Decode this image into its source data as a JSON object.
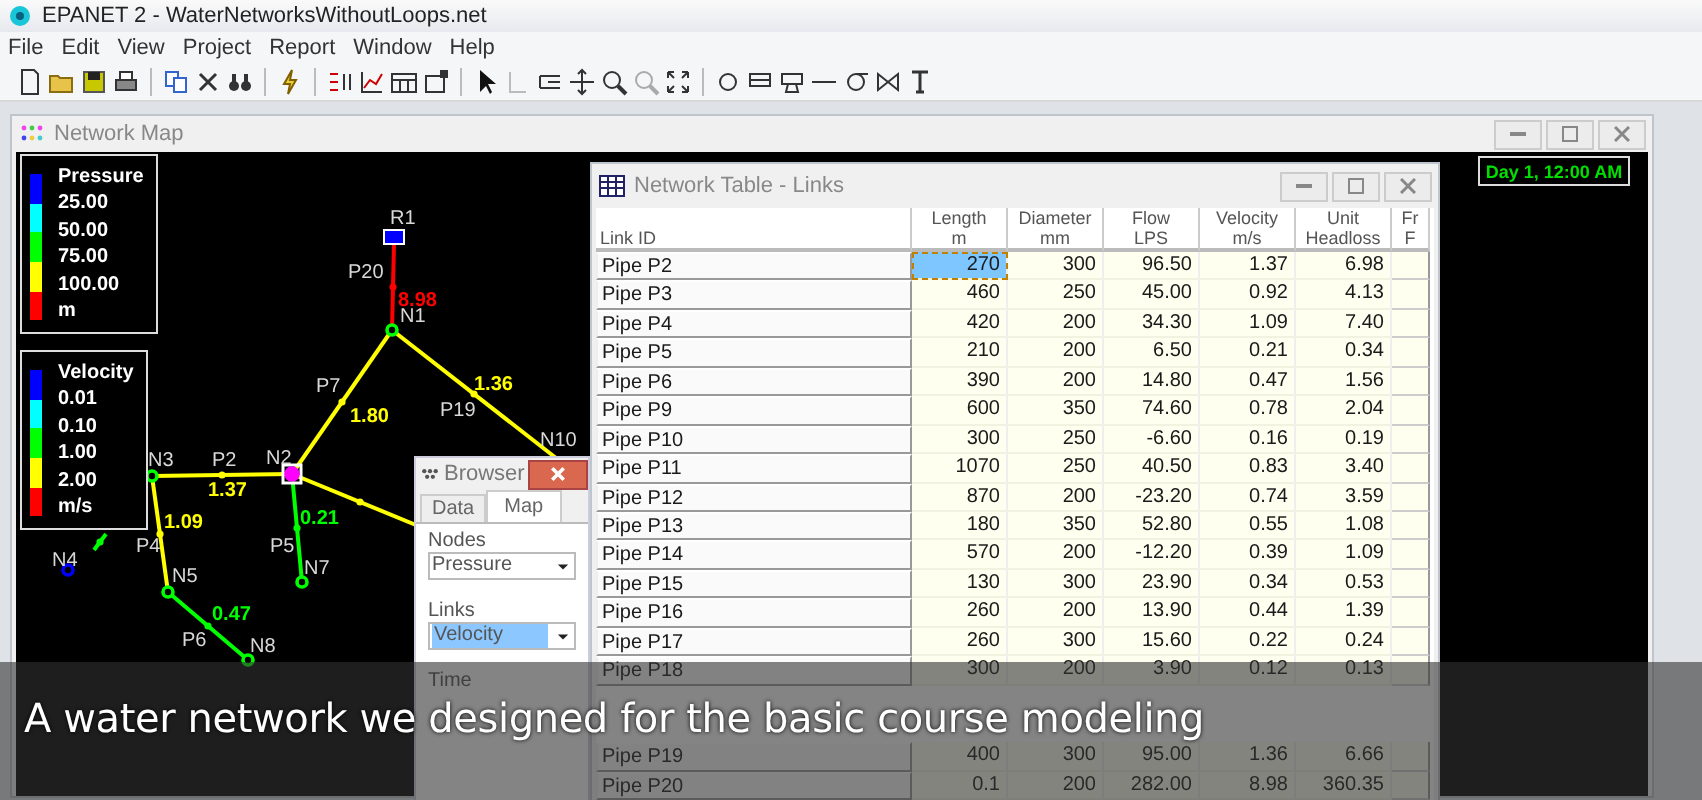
{
  "window": {
    "title": "EPANET 2 - WaterNetworksWithoutLoops.net"
  },
  "menu": [
    "File",
    "Edit",
    "View",
    "Project",
    "Report",
    "Window",
    "Help"
  ],
  "network_map": {
    "title": "Network Map",
    "time_label": "Day 1, 12:00 AM",
    "legends": [
      {
        "title": "Pressure",
        "entries": [
          "25.00",
          "50.00",
          "75.00",
          "100.00"
        ],
        "unit": "m"
      },
      {
        "title": "Velocity",
        "entries": [
          "0.01",
          "0.10",
          "1.00",
          "2.00"
        ],
        "unit": "m/s"
      }
    ],
    "nodes": [
      {
        "label": "R1",
        "kind": "reservoir",
        "color": "#0000ff",
        "selected": false
      },
      {
        "label": "N1",
        "kind": "junction",
        "color": "#00ff00",
        "selected": false
      },
      {
        "label": "N10"
      },
      {
        "label": "N3",
        "kind": "junction",
        "color": "#00ff00",
        "selected": false
      },
      {
        "label": "N2",
        "kind": "junction",
        "color": "#ff00ff",
        "selected": true
      },
      {
        "label": "N4",
        "kind": "junction",
        "color": "#0000ff",
        "selected": false
      },
      {
        "label": "N7",
        "kind": "junction",
        "color": "#00ff00",
        "selected": false
      },
      {
        "label": "N5",
        "kind": "junction",
        "color": "#00ff00",
        "selected": false
      },
      {
        "label": "N8",
        "kind": "junction",
        "color": "#00ff00",
        "selected": false
      }
    ],
    "links": [
      {
        "label": "P20",
        "value": "8.98",
        "color": "#ff0000"
      },
      {
        "label": "P7",
        "value": "1.80",
        "color": "#ffff00"
      },
      {
        "label": "P19",
        "value": "1.36",
        "color": "#ffff00"
      },
      {
        "label": "P2",
        "value": "1.37",
        "color": "#ffff00"
      },
      {
        "label": "P4",
        "value": "1.09",
        "color": "#ffff00"
      },
      {
        "label": "P5",
        "value": "0.21",
        "color": "#00ff00"
      },
      {
        "label": "P6",
        "value": "0.47",
        "color": "#00ff00"
      },
      {
        "color": "#ffff00"
      },
      {
        "color": "#00ff00"
      }
    ]
  },
  "table": {
    "title": "Network Table - Links",
    "columns": [
      {
        "label": "Link ID"
      },
      {
        "label": "Length",
        "unit": "m"
      },
      {
        "label": "Diameter",
        "unit": "mm"
      },
      {
        "label": "Flow",
        "unit": "LPS"
      },
      {
        "label": "Velocity",
        "unit": "m/s"
      },
      {
        "label": "Unit",
        "unit": "Headloss"
      },
      {
        "label": "Fr",
        "unit": "F"
      }
    ],
    "rows": [
      {
        "link_id": "Pipe P2",
        "values": [
          "270",
          "300",
          "96.50",
          "1.37",
          "6.98"
        ],
        "selected": true
      },
      {
        "link_id": "Pipe P3",
        "values": [
          "460",
          "250",
          "45.00",
          "0.92",
          "4.13"
        ],
        "selected": false
      },
      {
        "link_id": "Pipe P4",
        "values": [
          "420",
          "200",
          "34.30",
          "1.09",
          "7.40"
        ],
        "selected": false
      },
      {
        "link_id": "Pipe P5",
        "values": [
          "210",
          "200",
          "6.50",
          "0.21",
          "0.34"
        ],
        "selected": false
      },
      {
        "link_id": "Pipe P6",
        "values": [
          "390",
          "200",
          "14.80",
          "0.47",
          "1.56"
        ],
        "selected": false
      },
      {
        "link_id": "Pipe P9",
        "values": [
          "600",
          "350",
          "74.60",
          "0.78",
          "2.04"
        ],
        "selected": false
      },
      {
        "link_id": "Pipe P10",
        "values": [
          "300",
          "250",
          "-6.60",
          "0.16",
          "0.19"
        ],
        "selected": false
      },
      {
        "link_id": "Pipe P11",
        "values": [
          "1070",
          "250",
          "40.50",
          "0.83",
          "3.40"
        ],
        "selected": false
      },
      {
        "link_id": "Pipe P12",
        "values": [
          "870",
          "200",
          "-23.20",
          "0.74",
          "3.59"
        ],
        "selected": false
      },
      {
        "link_id": "Pipe P13",
        "values": [
          "180",
          "350",
          "52.80",
          "0.55",
          "1.08"
        ],
        "selected": false
      },
      {
        "link_id": "Pipe P14",
        "values": [
          "570",
          "200",
          "-12.20",
          "0.39",
          "1.09"
        ],
        "selected": false
      },
      {
        "link_id": "Pipe P15",
        "values": [
          "130",
          "300",
          "23.90",
          "0.34",
          "0.53"
        ],
        "selected": false
      },
      {
        "link_id": "Pipe P16",
        "values": [
          "260",
          "200",
          "13.90",
          "0.44",
          "1.39"
        ],
        "selected": false
      },
      {
        "link_id": "Pipe P17",
        "values": [
          "260",
          "300",
          "15.60",
          "0.22",
          "0.24"
        ],
        "selected": false
      },
      {
        "link_id": "Pipe P18",
        "values": [
          "300",
          "200",
          "3.90",
          "0.12",
          "0.13"
        ],
        "selected": false
      },
      {
        "selected": false
      },
      {
        "selected": false
      },
      {
        "link_id": "Pipe P19",
        "values": [
          "400",
          "300",
          "95.00",
          "1.36",
          "6.66"
        ],
        "selected": false
      },
      {
        "link_id": "Pipe P20",
        "values": [
          "0.1",
          "200",
          "282.00",
          "8.98",
          "360.35"
        ],
        "selected": false
      }
    ]
  },
  "browser": {
    "title": "Browser",
    "tabs": [
      {
        "label": "Data",
        "selected": false
      },
      {
        "label": "Map",
        "selected": true
      }
    ],
    "fields": [
      {
        "label": "Nodes",
        "value": "Pressure",
        "focused": false
      },
      {
        "label": "Links",
        "value": "Velocity",
        "focused": true
      },
      {
        "label": "Time"
      }
    ]
  },
  "caption": {
    "text": "A water network we designed for the basic course modeling"
  }
}
